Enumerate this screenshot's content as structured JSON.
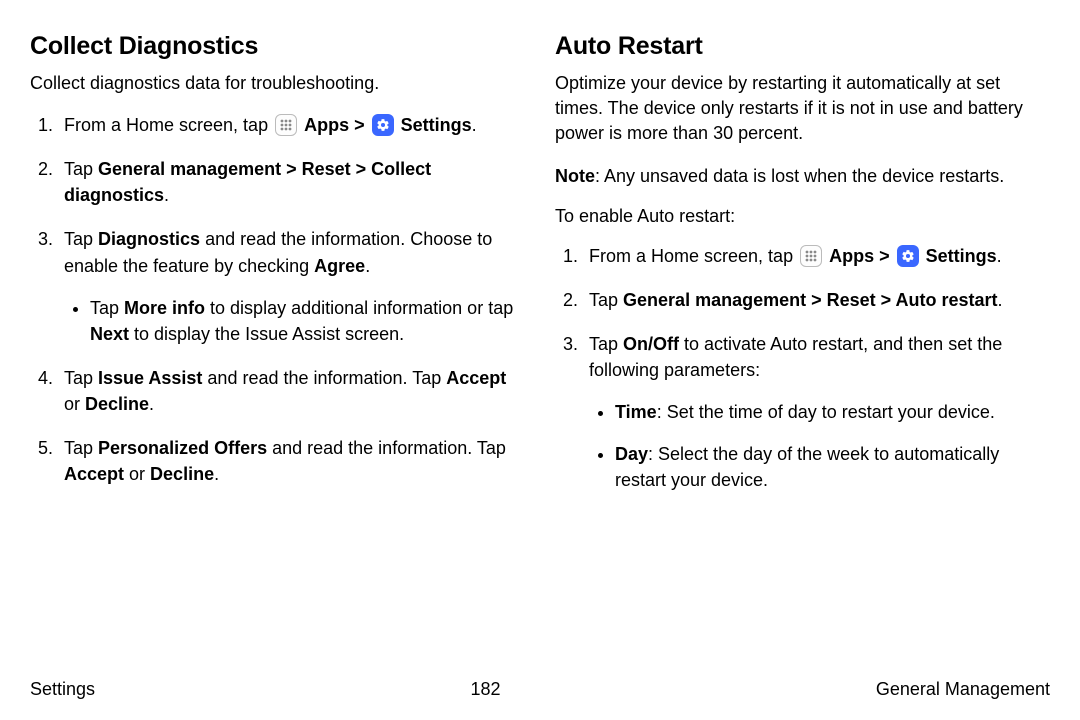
{
  "left": {
    "title": "Collect Diagnostics",
    "intro": "Collect diagnostics data for troubleshooting.",
    "step1_pre": "From a Home screen, tap ",
    "apps_label": "Apps",
    "sep": " > ",
    "settings_label": "Settings",
    "step2_pre": "Tap ",
    "step2_bold": "General management > Reset > Collect diagnostics",
    "step3_pre": "Tap ",
    "step3_bold1": "Diagnostics",
    "step3_mid": " and read the information. Choose to enable the feature by checking ",
    "step3_bold2": "Agree",
    "bullet1_pre": "Tap ",
    "bullet1_b1": "More info",
    "bullet1_mid": " to display additional information or tap ",
    "bullet1_b2": "Next",
    "bullet1_end": " to display the Issue Assist screen.",
    "step4_pre": "Tap ",
    "step4_b1": "Issue Assist",
    "step4_mid": " and read the information. Tap ",
    "step4_b2": "Accept",
    "step4_or": " or ",
    "step4_b3": "Decline",
    "step5_pre": "Tap ",
    "step5_b1": "Personalized Offers",
    "step5_mid": " and read the information. Tap ",
    "step5_b2": "Accept",
    "step5_or": " or ",
    "step5_b3": "Decline"
  },
  "right": {
    "title": "Auto Restart",
    "intro": "Optimize your device by restarting it automatically at set times. The device only restarts if it is not in use and battery power is more than 30 percent.",
    "note_b": "Note",
    "note_text": ": Any unsaved data is lost when the device restarts.",
    "enable": "To enable Auto restart:",
    "step1_pre": "From a Home screen, tap ",
    "apps_label": "Apps",
    "sep": " > ",
    "settings_label": "Settings",
    "step2_pre": "Tap ",
    "step2_bold": "General management > Reset > Auto restart",
    "step3_pre": "Tap ",
    "step3_b1": "On/Off",
    "step3_mid": " to activate Auto restart, and then set the following parameters:",
    "time_b": "Time",
    "time_text": ": Set the time of day to restart your device.",
    "day_b": "Day",
    "day_text": ": Select the day of the week to automatically restart your device."
  },
  "footer": {
    "left": "Settings",
    "center": "182",
    "right": "General Management"
  }
}
